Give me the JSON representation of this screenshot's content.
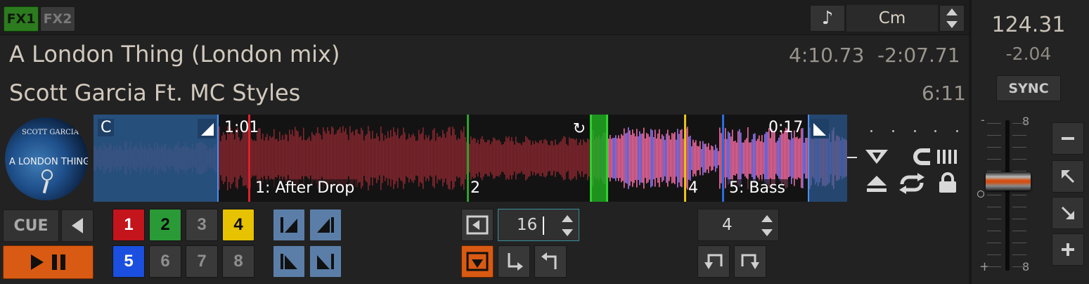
{
  "fx": {
    "fx1_label": "FX1",
    "fx2_label": "FX2"
  },
  "key": {
    "icon": "music-note-icon",
    "value": "Cm"
  },
  "track": {
    "title": "A London Thing (London mix)",
    "artist": "Scott Garcia Ft. MC Styles",
    "elapsed": "4:10.73",
    "remaining": "-2:07.71",
    "duration": "6:11"
  },
  "cover_art": {
    "line1": "SCOTT GARCIA",
    "line2": "A LONDON THING"
  },
  "bpm": {
    "value": "124.31",
    "offset": "-2.04",
    "sync_label": "SYNC"
  },
  "waveform": {
    "intro_label": "C",
    "time_left": "1:01",
    "time_right": "0:17",
    "cue_labels": [
      "1: After Drop",
      "2",
      "4",
      "5: Bass"
    ],
    "colors": {
      "cue1": "#e0202a",
      "cue2": "#2ea12e",
      "cue4": "#e8c516",
      "cue5": "#2a6de0",
      "played": "#9a2a34",
      "unplayed_a": "#ff6fa8",
      "unplayed_b": "#9a7cff",
      "loop_region": "#1fa11f",
      "intro_region": "#2c5a8f"
    }
  },
  "transport": {
    "cue_label": "CUE"
  },
  "hotcues": [
    {
      "label": "1",
      "color": "#c4141c",
      "text": "#ffffff"
    },
    {
      "label": "2",
      "color": "#2a9a36",
      "text": "#0b0b0b"
    },
    {
      "label": "3",
      "color": "#3a3a3a",
      "text": "#8f8f8f"
    },
    {
      "label": "4",
      "color": "#e6c200",
      "text": "#0b0b0b"
    },
    {
      "label": "5",
      "color": "#1a4fe0",
      "text": "#ffffff"
    },
    {
      "label": "6",
      "color": "#3a3a3a",
      "text": "#8f8f8f"
    },
    {
      "label": "7",
      "color": "#3a3a3a",
      "text": "#8f8f8f"
    },
    {
      "label": "8",
      "color": "#3a3a3a",
      "text": "#8f8f8f"
    }
  ],
  "loop": {
    "size": "16",
    "beatjump_size": "4"
  },
  "pitch_slider": {
    "top_label": "8",
    "bottom_label": "8",
    "minus": "-",
    "plus": "+",
    "position": 0.52
  }
}
